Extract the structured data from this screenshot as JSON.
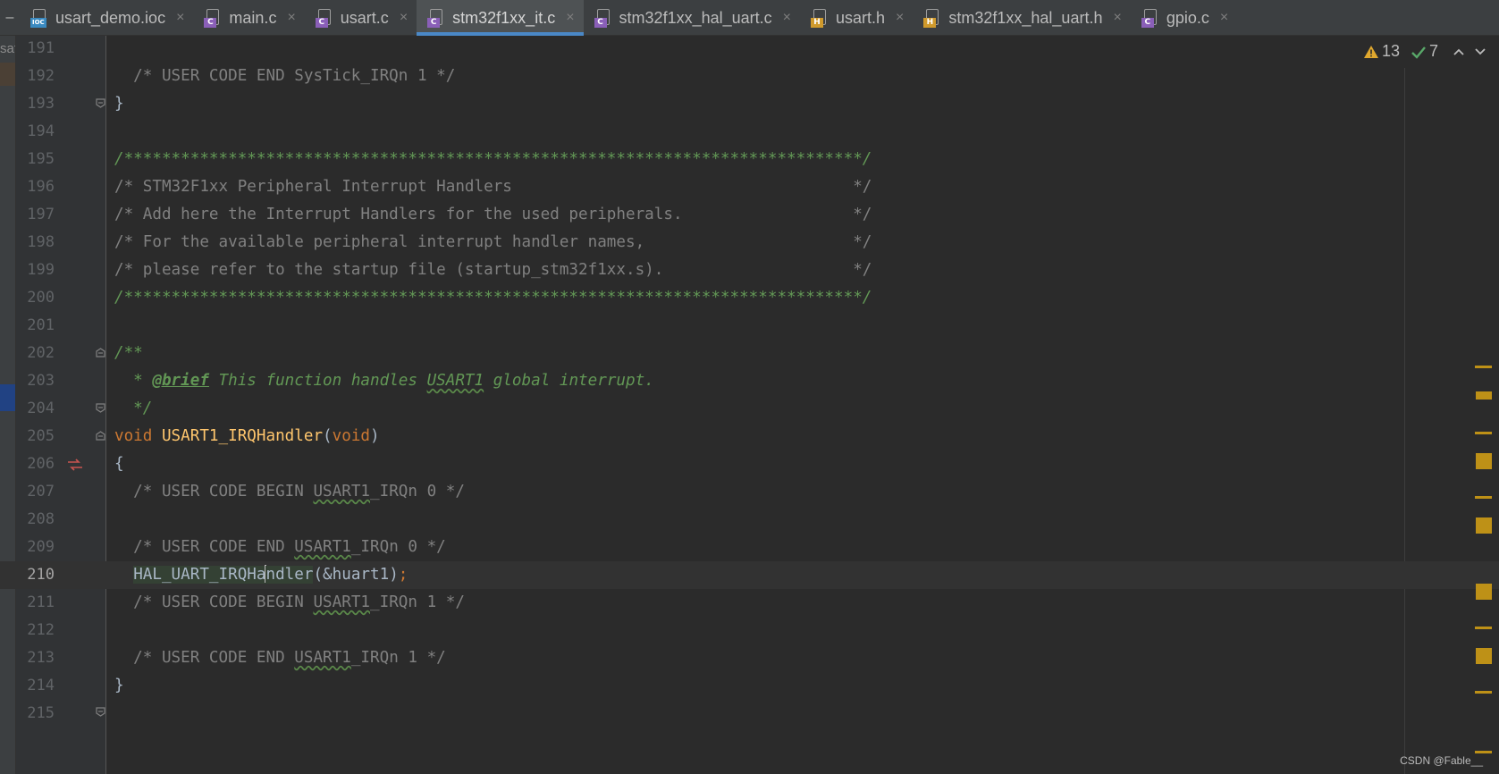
{
  "tabs": [
    {
      "label": "usart_demo.ioc",
      "icon": "ioc-file-icon",
      "badge": "IOC",
      "badge_kind": "ioc",
      "active": false
    },
    {
      "label": "main.c",
      "icon": "c-file-icon",
      "badge": "C",
      "badge_kind": "c",
      "active": false
    },
    {
      "label": "usart.c",
      "icon": "c-file-icon",
      "badge": "C",
      "badge_kind": "c",
      "active": false
    },
    {
      "label": "stm32f1xx_it.c",
      "icon": "c-file-icon",
      "badge": "C",
      "badge_kind": "c",
      "active": true
    },
    {
      "label": "stm32f1xx_hal_uart.c",
      "icon": "c-file-icon",
      "badge": "C",
      "badge_kind": "c",
      "active": false
    },
    {
      "label": "usart.h",
      "icon": "h-file-icon",
      "badge": "H",
      "badge_kind": "h",
      "active": false
    },
    {
      "label": "stm32f1xx_hal_uart.h",
      "icon": "h-file-icon",
      "badge": "H",
      "badge_kind": "h",
      "active": false
    },
    {
      "label": "gpio.c",
      "icon": "c-file-icon",
      "badge": "C",
      "badge_kind": "c",
      "active": false
    }
  ],
  "tab_close_glyph": "×",
  "left_panel": {
    "stub_glyph": "–",
    "partial_label": "sat"
  },
  "inspections": {
    "warnings_count": "13",
    "weak_warnings_count": "7",
    "warning_icon": "warning-triangle-icon",
    "check_icon": "check-icon"
  },
  "colors": {
    "background": "#2b2b2b",
    "keyword": "#cc7832",
    "function": "#ffc66d",
    "comment": "#808080",
    "doc_comment": "#629755",
    "identifier": "#a9b7c6",
    "active_tab_underline": "#4a88c7",
    "warning_stripe": "#be9117"
  },
  "editor": {
    "current_line": "210",
    "lines": [
      {
        "n": "191",
        "parts": []
      },
      {
        "n": "192",
        "parts": [
          {
            "t": "  /* USER CODE END SysTick_IRQn 1 */",
            "c": "cm"
          }
        ]
      },
      {
        "n": "193",
        "parts": [
          {
            "t": "}",
            "c": "plain"
          }
        ]
      },
      {
        "n": "194",
        "parts": []
      },
      {
        "n": "195",
        "parts": [
          {
            "t": "/******************************************************************************/",
            "c": "stars"
          }
        ]
      },
      {
        "n": "196",
        "parts": [
          {
            "t": "/* STM32F1xx Peripheral Interrupt Handlers                                    */",
            "c": "cm"
          }
        ]
      },
      {
        "n": "197",
        "parts": [
          {
            "t": "/* Add here the Interrupt Handlers for the used peripherals.                  */",
            "c": "cm"
          }
        ]
      },
      {
        "n": "198",
        "parts": [
          {
            "t": "/* For the available peripheral interrupt handler names,                      */",
            "c": "cm"
          }
        ]
      },
      {
        "n": "199",
        "parts": [
          {
            "t": "/* please refer to the startup file (startup_stm32f1xx.s).                    */",
            "c": "cm"
          }
        ]
      },
      {
        "n": "200",
        "parts": [
          {
            "t": "/******************************************************************************/",
            "c": "stars"
          }
        ]
      },
      {
        "n": "201",
        "parts": []
      },
      {
        "n": "202",
        "parts": [
          {
            "t": "/**",
            "c": "doc"
          }
        ]
      },
      {
        "n": "203",
        "parts": [
          {
            "t": "  * ",
            "c": "doc"
          },
          {
            "t": "@brief",
            "c": "doctag"
          },
          {
            "t": " This function handles ",
            "c": "doc"
          },
          {
            "t": "USART1",
            "c": "doc wavy"
          },
          {
            "t": " global interrupt.",
            "c": "doc"
          }
        ]
      },
      {
        "n": "204",
        "parts": [
          {
            "t": "  */",
            "c": "doc"
          }
        ]
      },
      {
        "n": "205",
        "parts": [
          {
            "t": "void",
            "c": "kw"
          },
          {
            "t": " ",
            "c": "plain"
          },
          {
            "t": "USART1_IRQHandler",
            "c": "fn"
          },
          {
            "t": "(",
            "c": "plain"
          },
          {
            "t": "void",
            "c": "kw"
          },
          {
            "t": ")",
            "c": "plain"
          }
        ]
      },
      {
        "n": "206",
        "parts": [
          {
            "t": "{",
            "c": "plain"
          }
        ]
      },
      {
        "n": "207",
        "parts": [
          {
            "t": "  /* USER CODE BEGIN ",
            "c": "cm"
          },
          {
            "t": "USART1",
            "c": "cm wavy"
          },
          {
            "t": "_IRQn 0 */",
            "c": "cm"
          }
        ]
      },
      {
        "n": "208",
        "parts": []
      },
      {
        "n": "209",
        "parts": [
          {
            "t": "  /* USER CODE END ",
            "c": "cm"
          },
          {
            "t": "USART1",
            "c": "cm wavy"
          },
          {
            "t": "_IRQn 0 */",
            "c": "cm"
          }
        ]
      },
      {
        "n": "210",
        "parts": [
          {
            "t": "  ",
            "c": "plain"
          },
          {
            "t": "HAL_UART_IRQHa",
            "c": "plain hl"
          },
          {
            "t": "",
            "c": "caret"
          },
          {
            "t": "ndler",
            "c": "plain hl"
          },
          {
            "t": "(&huart1)",
            "c": "plain"
          },
          {
            "t": ";",
            "c": "semi"
          }
        ]
      },
      {
        "n": "211",
        "parts": [
          {
            "t": "  /* USER CODE BEGIN ",
            "c": "cm"
          },
          {
            "t": "USART1",
            "c": "cm wavy"
          },
          {
            "t": "_IRQn 1 */",
            "c": "cm"
          }
        ]
      },
      {
        "n": "212",
        "parts": []
      },
      {
        "n": "213",
        "parts": [
          {
            "t": "  /* USER CODE END ",
            "c": "cm"
          },
          {
            "t": "USART1",
            "c": "cm wavy"
          },
          {
            "t": "_IRQn 1 */",
            "c": "cm"
          }
        ]
      },
      {
        "n": "214",
        "parts": [
          {
            "t": "}",
            "c": "plain"
          }
        ]
      },
      {
        "n": "215",
        "parts": []
      }
    ]
  },
  "watermark": "CSDN @Fable__"
}
